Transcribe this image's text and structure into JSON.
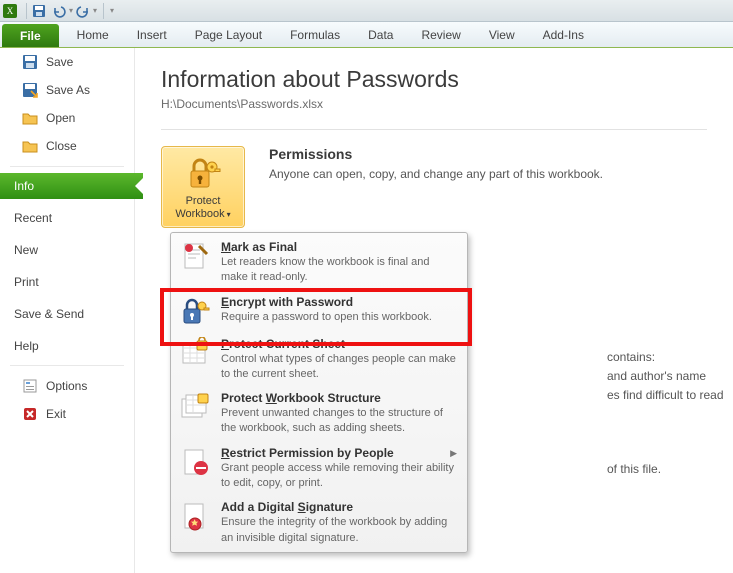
{
  "titlebar": {
    "app_icon": "excel-icon",
    "qat": [
      "save-icon",
      "undo-icon",
      "redo-icon"
    ]
  },
  "ribbon": {
    "file_label": "File",
    "tabs": [
      "Home",
      "Insert",
      "Page Layout",
      "Formulas",
      "Data",
      "Review",
      "View",
      "Add-Ins"
    ]
  },
  "sidebar": {
    "save": "Save",
    "save_as": "Save As",
    "open": "Open",
    "close": "Close",
    "info": "Info",
    "recent": "Recent",
    "new": "New",
    "print": "Print",
    "save_send": "Save & Send",
    "help": "Help",
    "options": "Options",
    "exit": "Exit"
  },
  "main": {
    "title": "Information about Passwords",
    "path": "H:\\Documents\\Passwords.xlsx",
    "permissions": {
      "heading": "Permissions",
      "body": "Anyone can open, copy, and change any part of this workbook.",
      "button_line1": "Protect",
      "button_line2": "Workbook"
    },
    "prepare_fragments": {
      "l1": "contains:",
      "l2": "and author's name",
      "l3": "es find difficult to read"
    },
    "versions_fragment": "of this file."
  },
  "menu": {
    "items": [
      {
        "title": "Mark as Final",
        "desc": "Let readers know the workbook is final and make it read-only."
      },
      {
        "title": "Encrypt with Password",
        "desc": "Require a password to open this workbook."
      },
      {
        "title": "Protect Current Sheet",
        "desc": "Control what types of changes people can make to the current sheet."
      },
      {
        "title": "Protect Workbook Structure",
        "desc": "Prevent unwanted changes to the structure of the workbook, such as adding sheets."
      },
      {
        "title": "Restrict Permission by People",
        "desc": "Grant people access while removing their ability to edit, copy, or print."
      },
      {
        "title": "Add a Digital Signature",
        "desc": "Ensure the integrity of the workbook by adding an invisible digital signature."
      }
    ]
  }
}
